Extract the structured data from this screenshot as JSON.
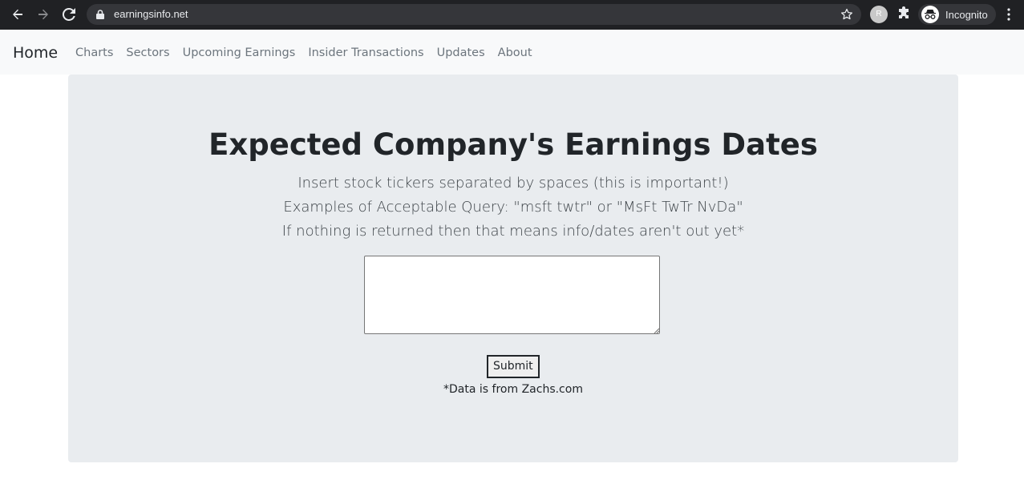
{
  "browser": {
    "url": "earningsinfo.net",
    "profile_initial": "R",
    "incognito_label": "Incognito"
  },
  "nav": {
    "brand": "Home",
    "links": [
      "Charts",
      "Sectors",
      "Upcoming Earnings",
      "Insider Transactions",
      "Updates",
      "About"
    ]
  },
  "main": {
    "title": "Expected Company's Earnings Dates",
    "instruction_1": "Insert stock tickers separated by spaces (this is important!)",
    "instruction_2": "Examples of Acceptable Query: \"msft twtr\" or \"MsFt TwTr NvDa\"",
    "instruction_3": "If nothing is returned then that means info/dates aren't out yet*",
    "ticker_input_value": "",
    "submit_label": "Submit",
    "source_note": "*Data is from Zachs.com"
  },
  "colors": {
    "chrome_bg": "#202124",
    "nav_bg": "#f8f9fa",
    "jumbotron_bg": "#e9ecef",
    "nav_link": "#6c757d",
    "text": "#212529"
  }
}
